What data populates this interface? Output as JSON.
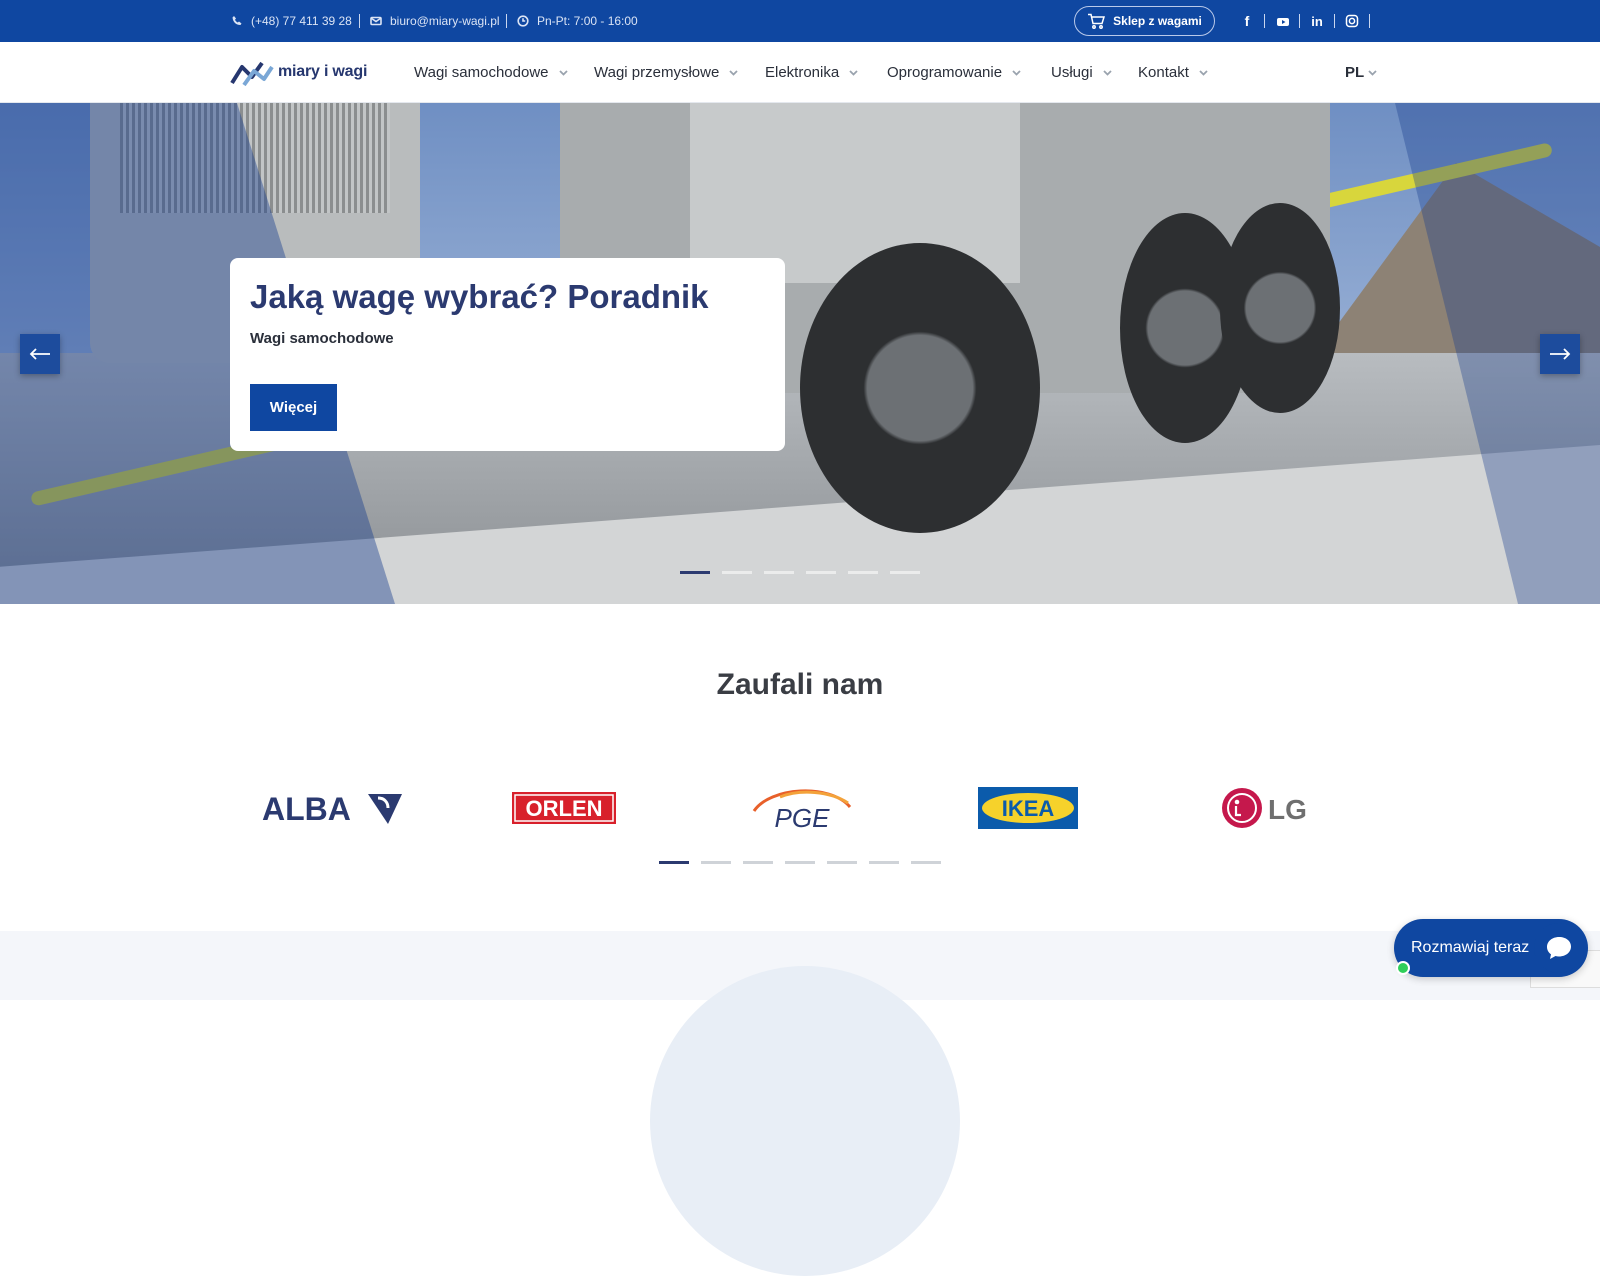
{
  "topbar": {
    "phone": "(+48) 77 411 39 28",
    "email": "biuro@miary-wagi.pl",
    "hours": "Pn-Pt: 7:00 - 16:00",
    "shop_label": "Sklep z wagami",
    "social_icons": [
      "facebook-icon",
      "youtube-icon",
      "linkedin-icon",
      "instagram-icon"
    ],
    "bg_color": "#0f47a1"
  },
  "header": {
    "logo_text": "miary i wagi",
    "nav": [
      {
        "label": "Wagi samochodowe"
      },
      {
        "label": "Wagi przemysłowe"
      },
      {
        "label": "Elektronika"
      },
      {
        "label": "Oprogramowanie"
      },
      {
        "label": "Usługi"
      },
      {
        "label": "Kontakt"
      }
    ],
    "language": "PL"
  },
  "hero": {
    "title": "Jaką wagę wybrać? Poradnik",
    "subtitle": "Wagi samochodowe",
    "button_label": "Więcej",
    "slide_count": 6,
    "active_slide": 1,
    "accent_color": "#2b3a70"
  },
  "trust": {
    "title": "Zaufali nam",
    "logos": [
      "ALBA",
      "ORLEN",
      "PGE",
      "IKEA",
      "LG"
    ],
    "page_count": 7,
    "active_page": 1
  },
  "chat": {
    "label": "Rozmawiaj teraz"
  }
}
